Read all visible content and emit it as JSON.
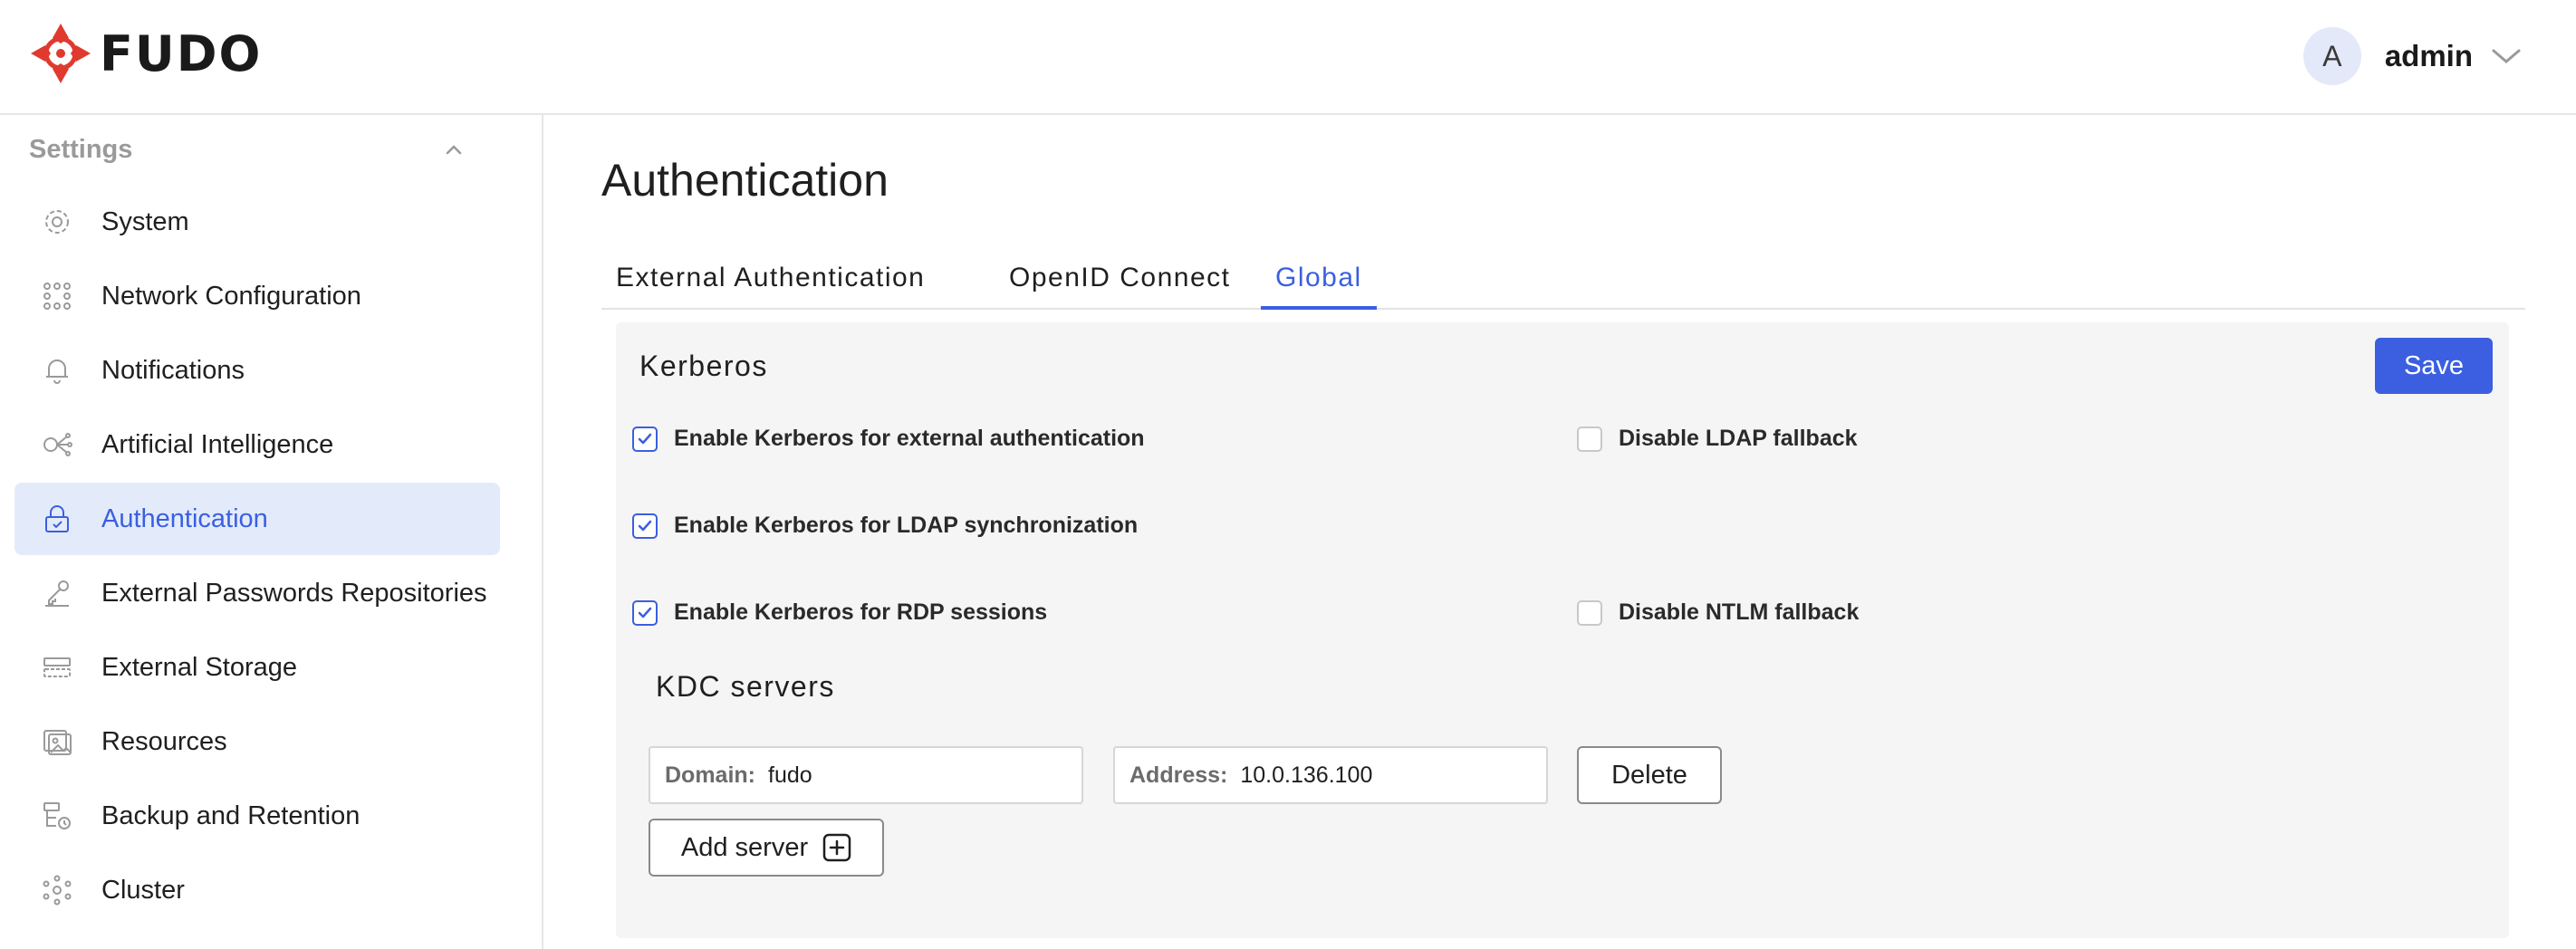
{
  "header": {
    "logo_text": "FUDO",
    "avatar_initial": "A",
    "user_name": "admin"
  },
  "sidebar": {
    "section_title": "Settings",
    "items": [
      {
        "label": "System",
        "icon": "gear-icon"
      },
      {
        "label": "Network Configuration",
        "icon": "network-icon"
      },
      {
        "label": "Notifications",
        "icon": "bell-icon"
      },
      {
        "label": "Artificial Intelligence",
        "icon": "ai-icon"
      },
      {
        "label": "Authentication",
        "icon": "lock-icon",
        "active": true
      },
      {
        "label": "External Passwords Repositories",
        "icon": "key-icon"
      },
      {
        "label": "External Storage",
        "icon": "storage-icon"
      },
      {
        "label": "Resources",
        "icon": "image-icon"
      },
      {
        "label": "Backup and Retention",
        "icon": "backup-icon"
      },
      {
        "label": "Cluster",
        "icon": "cluster-icon"
      }
    ]
  },
  "main": {
    "title": "Authentication",
    "tabs": [
      {
        "label": "External Authentication"
      },
      {
        "label": "OpenID Connect"
      },
      {
        "label": "Global",
        "active": true
      }
    ],
    "kerberos": {
      "title": "Kerberos",
      "save_label": "Save",
      "options": [
        {
          "label": "Enable Kerberos for external authentication",
          "checked": true
        },
        {
          "label": "Disable LDAP fallback",
          "checked": false
        },
        {
          "label": "Enable Kerberos for LDAP synchronization",
          "checked": true
        },
        {
          "label": "Enable Kerberos for RDP sessions",
          "checked": true
        },
        {
          "label": "Disable NTLM fallback",
          "checked": false
        }
      ],
      "kdc": {
        "title": "KDC servers",
        "domain_label": "Domain:",
        "domain_value": "fudo",
        "address_label": "Address:",
        "address_value": "10.0.136.100",
        "delete_label": "Delete",
        "add_label": "Add server"
      }
    }
  },
  "colors": {
    "accent": "#3b5fe0",
    "active_bg": "#e3ebfb",
    "logo_red": "#e03a2f"
  }
}
